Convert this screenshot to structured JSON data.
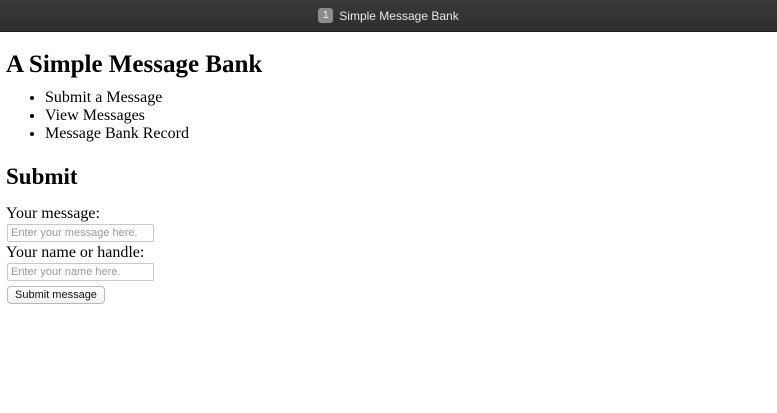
{
  "window": {
    "tab_index": "1",
    "title": "Simple Message Bank"
  },
  "page": {
    "heading": "A Simple Message Bank",
    "nav_items": [
      "Submit a Message",
      "View Messages",
      "Message Bank Record"
    ],
    "section_heading": "Submit",
    "form": {
      "message_label": "Your message:",
      "message_placeholder": "Enter your message here.",
      "name_label": "Your name or handle:",
      "name_placeholder": "Enter your name here.",
      "submit_label": "Submit message"
    }
  }
}
